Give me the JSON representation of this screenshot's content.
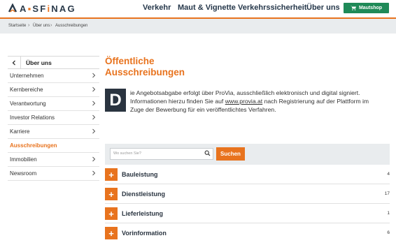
{
  "header": {
    "logo_letters": [
      "A",
      "S",
      "F",
      "i",
      "N",
      "A",
      "G"
    ],
    "nav": [
      "Verkehr",
      "Maut & Vignette",
      "Verkehrssicherheit",
      "Über uns"
    ],
    "shop_label": "Mautshop"
  },
  "breadcrumb": [
    "Startseite",
    "Über uns",
    "Ausschreibungen"
  ],
  "sidebar": {
    "heading": "Über uns",
    "items": [
      {
        "label": "Unternehmen"
      },
      {
        "label": "Kernbereiche"
      },
      {
        "label": "Verantwortung"
      },
      {
        "label": "Investor Relations"
      },
      {
        "label": "Karriere"
      },
      {
        "label": "Ausschreibungen"
      },
      {
        "label": "Immobilien"
      },
      {
        "label": "Newsroom"
      }
    ]
  },
  "main": {
    "title_line1": "Öffentliche",
    "title_line2": "Ausschreibungen",
    "dropcap": "D",
    "intro": {
      "line1": "ie Angebotsabgabe erfolgt über ProVia, ausschließlich elektronisch und digital signiert.",
      "line2_pre": "Informationen hierzu finden Sie auf ",
      "line2_link": "www.provia.at",
      "line2_post": " nach Registrierung auf der Plattform im",
      "line3": "Zuge der Bewerbung für ein veröffentlichtes Verfahren."
    }
  },
  "search": {
    "placeholder": "Wo suchen Sie?",
    "button_label": "Suchen"
  },
  "categories": [
    {
      "label": "Bauleistung",
      "count": "4"
    },
    {
      "label": "Dienstleistung",
      "count": "17"
    },
    {
      "label": "Lieferleistung",
      "count": "1"
    },
    {
      "label": "Vorinformation",
      "count": "6"
    }
  ],
  "colors": {
    "accent": "#e8731e",
    "shop_green": "#1f8a58",
    "dark": "#2a3440"
  }
}
